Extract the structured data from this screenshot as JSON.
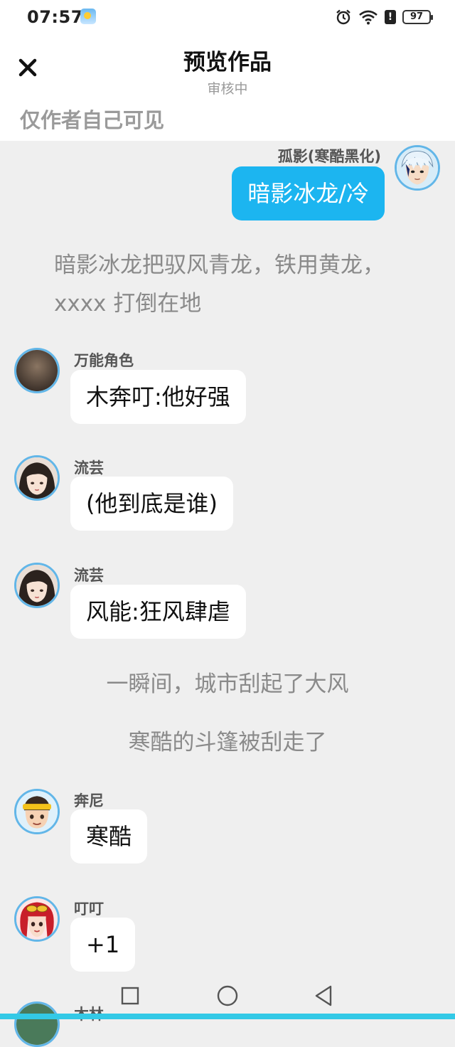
{
  "status_bar": {
    "time": "07:57",
    "weather_icon": "weather-sun-icon",
    "battery": "97",
    "icons": [
      "alarm-icon",
      "wifi-icon",
      "alert-icon",
      "battery-icon"
    ]
  },
  "header": {
    "close_icon": "close-icon",
    "title": "预览作品",
    "subtitle": "审核中",
    "visibility": "仅作者自己可见"
  },
  "messages": [
    {
      "speaker": "孤影(寒酷黑化)",
      "text": "暗影冰龙/冷",
      "side": "right",
      "avatar": "guying-avatar"
    },
    {
      "narration": "暗影冰龙把驭风青龙，铁用黄龙，xxxx 打倒在地"
    },
    {
      "speaker": "万能角色",
      "text": "木奔叮:他好强",
      "side": "left",
      "avatar": "wanneng-avatar"
    },
    {
      "speaker": "流芸",
      "text": "(他到底是谁)",
      "side": "left",
      "avatar": "liuyun-avatar"
    },
    {
      "speaker": "流芸",
      "text": "风能:狂风肆虐",
      "side": "left",
      "avatar": "liuyun-avatar"
    },
    {
      "narration": "一瞬间，城市刮起了大风"
    },
    {
      "narration": "寒酷的斗篷被刮走了"
    },
    {
      "speaker": "奔尼",
      "text": "寒酷",
      "side": "left",
      "avatar": "benni-avatar"
    },
    {
      "speaker": "叮叮",
      "text": "+1",
      "side": "left",
      "avatar": "dingding-avatar"
    },
    {
      "speaker": "木林",
      "text": "",
      "side": "left",
      "avatar": "mulin-avatar"
    }
  ],
  "navigation": {
    "buttons": [
      "recent-apps-button",
      "home-button",
      "back-button"
    ]
  },
  "colors": {
    "accent": "#1cb5f0",
    "background": "#efefef",
    "avatar_border": "#62b6e8",
    "bottom_bar": "#33c9e6"
  }
}
